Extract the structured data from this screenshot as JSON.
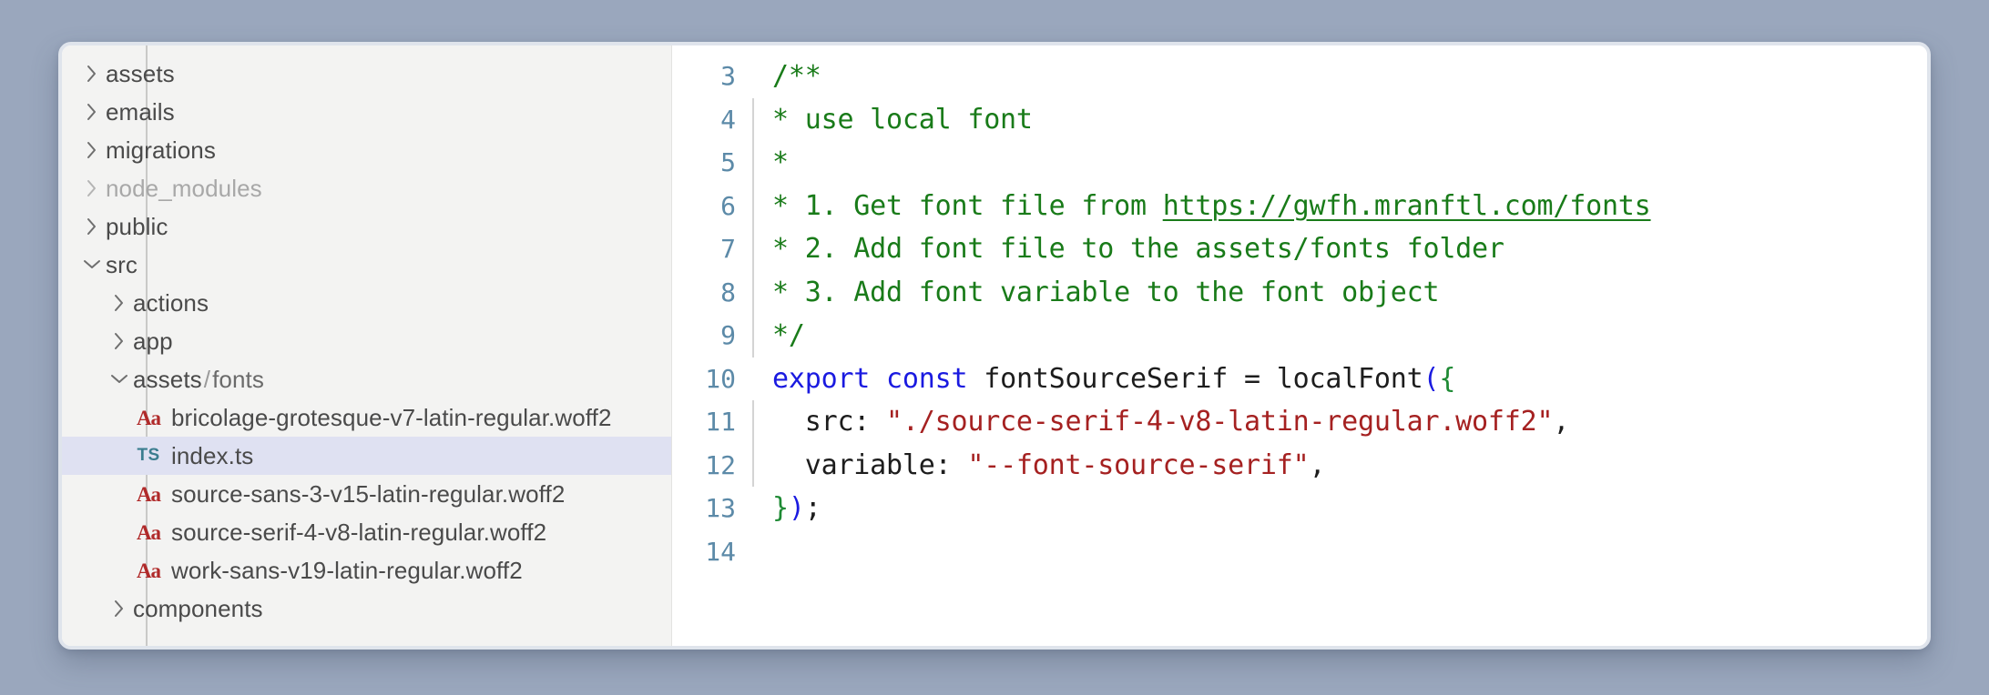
{
  "window": {
    "background_color": "#9aa7bd",
    "surface_color": "#ffffff"
  },
  "sidebar": {
    "background_color": "#f3f3f2",
    "selected_color": "#dfe1f2",
    "items": [
      {
        "label": "assets",
        "kind": "folder",
        "level": 0,
        "expanded": false,
        "dim": false
      },
      {
        "label": "emails",
        "kind": "folder",
        "level": 0,
        "expanded": false,
        "dim": false
      },
      {
        "label": "migrations",
        "kind": "folder",
        "level": 0,
        "expanded": false,
        "dim": false
      },
      {
        "label": "node_modules",
        "kind": "folder",
        "level": 0,
        "expanded": false,
        "dim": true
      },
      {
        "label": "public",
        "kind": "folder",
        "level": 0,
        "expanded": false,
        "dim": false
      },
      {
        "label": "src",
        "kind": "folder",
        "level": 0,
        "expanded": true,
        "dim": false
      },
      {
        "label": "actions",
        "kind": "folder",
        "level": 1,
        "expanded": false,
        "dim": false
      },
      {
        "label": "app",
        "kind": "folder",
        "level": 1,
        "expanded": false,
        "dim": false
      },
      {
        "label": "assets",
        "label2": "fonts",
        "separator": "/",
        "kind": "folder",
        "level": 1,
        "expanded": true,
        "dim": false
      },
      {
        "label": "bricolage-grotesque-v7-latin-regular.woff2",
        "kind": "font",
        "icon": "font-file-icon",
        "icon_text": "Aa",
        "level": 2,
        "selected": false
      },
      {
        "label": "index.ts",
        "kind": "ts",
        "icon": "typescript-file-icon",
        "icon_text": "TS",
        "level": 2,
        "selected": true
      },
      {
        "label": "source-sans-3-v15-latin-regular.woff2",
        "kind": "font",
        "icon": "font-file-icon",
        "icon_text": "Aa",
        "level": 2,
        "selected": false
      },
      {
        "label": "source-serif-4-v8-latin-regular.woff2",
        "kind": "font",
        "icon": "font-file-icon",
        "icon_text": "Aa",
        "level": 2,
        "selected": false
      },
      {
        "label": "work-sans-v19-latin-regular.woff2",
        "kind": "font",
        "icon": "font-file-icon",
        "icon_text": "Aa",
        "level": 2,
        "selected": false
      },
      {
        "label": "components",
        "kind": "folder",
        "level": 1,
        "expanded": false,
        "dim": false
      }
    ]
  },
  "editor": {
    "colors": {
      "line_number": "#5c8aa8",
      "comment": "#197b19",
      "keyword": "#1a1ae0",
      "string": "#a52121",
      "plain": "#1d1d1d"
    },
    "lines": [
      {
        "number": "3",
        "guide": false,
        "tokens": [
          {
            "t": "/**",
            "c": "comment"
          }
        ]
      },
      {
        "number": "4",
        "guide": true,
        "tokens": [
          {
            "t": "* use local font",
            "c": "comment"
          }
        ]
      },
      {
        "number": "5",
        "guide": true,
        "tokens": [
          {
            "t": "*",
            "c": "comment"
          }
        ]
      },
      {
        "number": "6",
        "guide": true,
        "tokens": [
          {
            "t": "* 1. Get font file from ",
            "c": "comment"
          },
          {
            "t": "https://gwfh.mranftl.com/fonts",
            "c": "link"
          }
        ]
      },
      {
        "number": "7",
        "guide": true,
        "tokens": [
          {
            "t": "* 2. Add font file to the assets/fonts folder",
            "c": "comment"
          }
        ]
      },
      {
        "number": "8",
        "guide": true,
        "tokens": [
          {
            "t": "* 3. Add font variable to the font object",
            "c": "comment"
          }
        ]
      },
      {
        "number": "9",
        "guide": true,
        "tokens": [
          {
            "t": "*/",
            "c": "comment"
          }
        ]
      },
      {
        "number": "10",
        "guide": false,
        "tokens": [
          {
            "t": "export",
            "c": "keyword"
          },
          {
            "t": " ",
            "c": "plain"
          },
          {
            "t": "const",
            "c": "keyword"
          },
          {
            "t": " fontSourceSerif = localFont",
            "c": "plain"
          },
          {
            "t": "(",
            "c": "paren-blue"
          },
          {
            "t": "{",
            "c": "brace-green"
          }
        ]
      },
      {
        "number": "11",
        "guide": true,
        "tokens": [
          {
            "t": "  src: ",
            "c": "plain"
          },
          {
            "t": "\"./source-serif-4-v8-latin-regular.woff2\"",
            "c": "string"
          },
          {
            "t": ",",
            "c": "plain"
          }
        ]
      },
      {
        "number": "12",
        "guide": true,
        "tokens": [
          {
            "t": "  variable: ",
            "c": "plain"
          },
          {
            "t": "\"--font-source-serif\"",
            "c": "string"
          },
          {
            "t": ",",
            "c": "plain"
          }
        ]
      },
      {
        "number": "13",
        "guide": false,
        "tokens": [
          {
            "t": "}",
            "c": "brace-green"
          },
          {
            "t": ")",
            "c": "paren-blue"
          },
          {
            "t": ";",
            "c": "plain"
          }
        ]
      },
      {
        "number": "14",
        "guide": false,
        "tokens": []
      }
    ]
  }
}
